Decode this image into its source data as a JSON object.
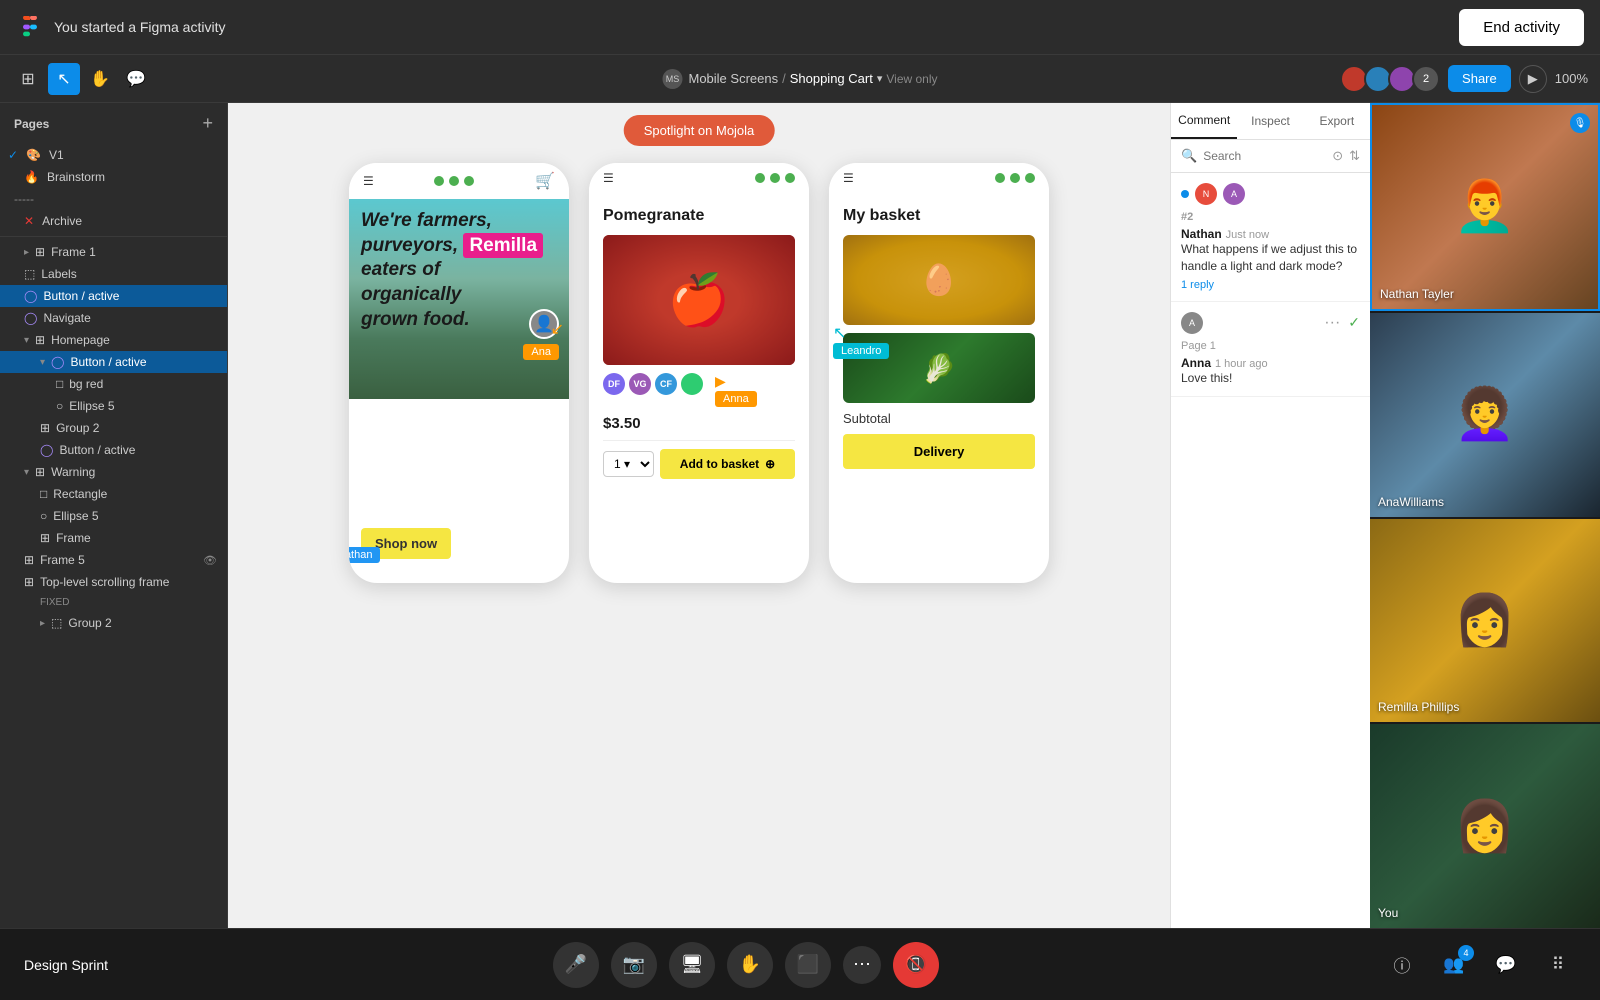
{
  "topbar": {
    "title": "You started a Figma activity",
    "end_activity": "End activity"
  },
  "toolbar": {
    "breadcrumb_workspace": "Mobile Screens",
    "breadcrumb_separator": "/",
    "breadcrumb_file": "Shopping Cart",
    "view_only": "View only",
    "avatar_count": "2",
    "share_label": "Share",
    "zoom": "100%"
  },
  "pages": {
    "header": "Pages",
    "v1": "V1",
    "brainstorm": "Brainstorm",
    "archive": "Archive"
  },
  "layers": [
    {
      "id": "frame1",
      "label": "Frame 1",
      "icon": "⊞",
      "indent": 1
    },
    {
      "id": "labels",
      "label": "Labels",
      "icon": "⬚",
      "indent": 1
    },
    {
      "id": "button-active-1",
      "label": "Button / active",
      "icon": "◯",
      "indent": 1,
      "selected": true
    },
    {
      "id": "navigate",
      "label": "Navigate",
      "icon": "◯",
      "indent": 1
    },
    {
      "id": "homepage",
      "label": "Homepage",
      "icon": "⊞",
      "indent": 1
    },
    {
      "id": "button-active-2",
      "label": "Button / active",
      "icon": "◯",
      "indent": 2
    },
    {
      "id": "bg-red",
      "label": "bg red",
      "icon": "□",
      "indent": 3
    },
    {
      "id": "ellipse5",
      "label": "Ellipse 5",
      "icon": "○",
      "indent": 3
    },
    {
      "id": "group2",
      "label": "Group 2",
      "icon": "⊞",
      "indent": 2
    },
    {
      "id": "button-active-3",
      "label": "Button / active",
      "icon": "◯",
      "indent": 2
    },
    {
      "id": "warning",
      "label": "Warning",
      "icon": "⊞",
      "indent": 1
    },
    {
      "id": "rectangle",
      "label": "Rectangle",
      "icon": "□",
      "indent": 2
    },
    {
      "id": "ellipse5b",
      "label": "Ellipse 5",
      "icon": "○",
      "indent": 2
    },
    {
      "id": "frame",
      "label": "Frame",
      "icon": "⊞",
      "indent": 2
    },
    {
      "id": "frame5",
      "label": "Frame 5",
      "icon": "⊞",
      "indent": 1
    },
    {
      "id": "top-level",
      "label": "Top-level scrolling frame",
      "icon": "⊞",
      "indent": 1
    },
    {
      "id": "fixed",
      "label": "FIXED",
      "icon": "",
      "indent": 2
    },
    {
      "id": "group2b",
      "label": "Group 2",
      "icon": "⬚",
      "indent": 2
    }
  ],
  "spotlight": "Spotlight on Mojola",
  "canvas": {
    "frame1": {
      "text": "We're farmers, purveyors, eaters of organically grown food.",
      "highlight": "Remilla",
      "shop_btn": "Shop now"
    },
    "frame2": {
      "product": "Pomegranate",
      "price": "$3.50",
      "basket_btn": "Add to basket"
    },
    "frame3": {
      "title": "My basket",
      "subtotal": "Subtotal",
      "delivery": "Delivery"
    }
  },
  "cursors": [
    {
      "id": "leandro",
      "label": "Leandro",
      "color": "#00bcd4"
    },
    {
      "id": "ana",
      "label": "Ana",
      "color": "#ff9800"
    },
    {
      "id": "nathan",
      "label": "Nathan",
      "color": "#2196f3"
    }
  ],
  "comments": {
    "tabs": [
      "Comment",
      "Inspect",
      "Export"
    ],
    "active_tab": "Comment",
    "search_placeholder": "Search",
    "items": [
      {
        "id": 1,
        "number": "#2",
        "author": "Nathan",
        "time": "Just now",
        "text": "What happens if we adjust this to handle a light and dark mode?",
        "reply_count": "1 reply"
      },
      {
        "id": 2,
        "page": "Page 1",
        "author": "Anna",
        "time": "1 hour ago",
        "text": "Love this!"
      }
    ]
  },
  "video_participants": [
    {
      "id": "nathan",
      "name": "Nathan Tayler",
      "active_speaker": true
    },
    {
      "id": "ana",
      "name": "AnaWilliams"
    },
    {
      "id": "remilla",
      "name": "Remilla Phillips"
    },
    {
      "id": "you",
      "name": "You"
    }
  ],
  "bottom_bar": {
    "session_name": "Design Sprint",
    "controls": [
      "mic",
      "camera",
      "screen-share",
      "hand",
      "present",
      "more",
      "end-call"
    ],
    "right_icons": [
      "info",
      "people",
      "chat",
      "apps"
    ],
    "people_badge": "4"
  }
}
